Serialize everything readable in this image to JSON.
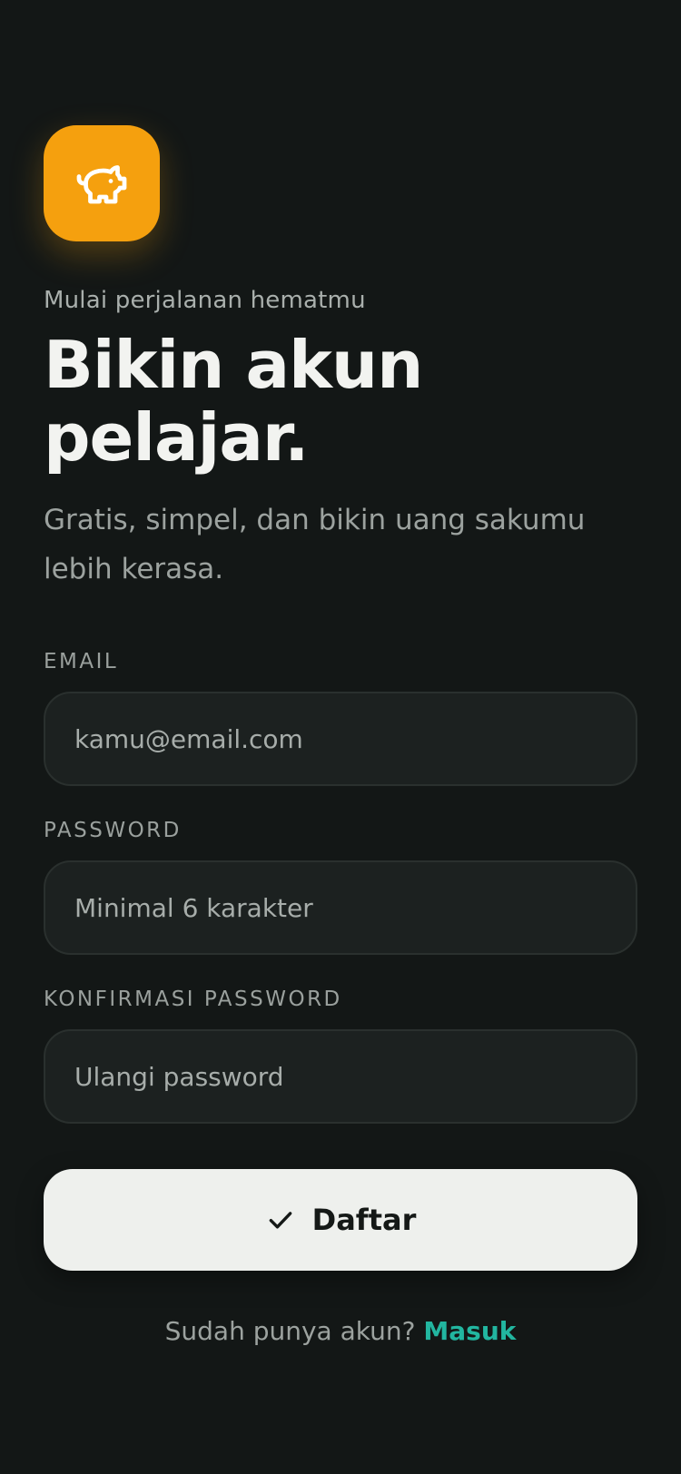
{
  "logo": {
    "icon": "piggy-bank-icon",
    "background_color": "#f5a00e"
  },
  "header": {
    "eyebrow": "Mulai perjalanan hematmu",
    "title_line_1": "Bikin akun",
    "title_line_2": "pelajar.",
    "subtitle": "Gratis, simpel, dan bikin uang sakumu lebih kerasa."
  },
  "form": {
    "email": {
      "label": "EMAIL",
      "placeholder": "kamu@email.com",
      "value": ""
    },
    "password": {
      "label": "PASSWORD",
      "placeholder": "Minimal 6 karakter",
      "value": ""
    },
    "confirm_password": {
      "label": "KONFIRMASI PASSWORD",
      "placeholder": "Ulangi password",
      "value": ""
    },
    "submit": {
      "icon": "check-icon",
      "label": "Daftar"
    }
  },
  "footer": {
    "prompt": "Sudah punya akun?",
    "login_link": "Masuk",
    "link_color": "#22b6a0"
  }
}
